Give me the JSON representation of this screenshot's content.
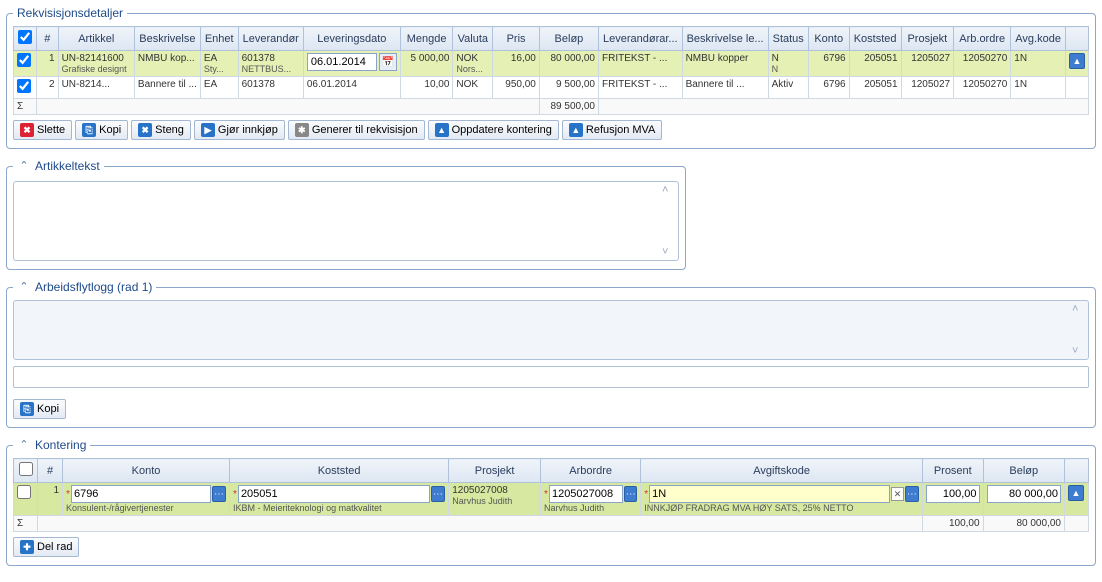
{
  "rekv": {
    "legend": "Rekvisisjonsdetaljer",
    "headers": [
      "#",
      "Artikkel",
      "Beskrivelse",
      "Enhet",
      "Leverandør",
      "Leveringsdato",
      "Mengde",
      "Valuta",
      "Pris",
      "Beløp",
      "Leverandørar...",
      "Beskrivelse le...",
      "Status",
      "Konto",
      "Koststed",
      "Prosjekt",
      "Arb.ordre",
      "Avg.kode"
    ],
    "rows": [
      {
        "num": "1",
        "art": "UN-82141600",
        "art_sub": "Grafiske designt",
        "besk": "NMBU kop...",
        "enh": "EA",
        "enh_sub": "Sty...",
        "lev": "601378",
        "lev_sub": "NETTBUS...",
        "levd": "06.01.2014",
        "meng": "5 000,00",
        "val": "NOK",
        "val_sub": "Nors...",
        "pris": "16,00",
        "bel": "80 000,00",
        "levar": "FRITEKST - ...",
        "beskl": "NMBU kopper",
        "stat": "N",
        "stat_sub": "N",
        "konto": "6796",
        "kost": "205051",
        "pros": "1205027",
        "arb": "12050270",
        "avg": "1N",
        "selected": true
      },
      {
        "num": "2",
        "art": "UN-8214...",
        "besk": "Bannere til ...",
        "enh": "EA",
        "lev": "601378",
        "levd": "06.01.2014",
        "meng": "10,00",
        "val": "NOK",
        "pris": "950,00",
        "bel": "9 500,00",
        "levar": "FRITEKST - ...",
        "beskl": "Bannere til ...",
        "stat": "Aktiv",
        "konto": "6796",
        "kost": "205051",
        "pros": "1205027",
        "arb": "12050270",
        "avg": "1N",
        "selected": true
      }
    ],
    "sum_label": "Σ",
    "sum_bel": "89 500,00",
    "buttons": {
      "slette": "Slette",
      "kopi": "Kopi",
      "steng": "Steng",
      "gjor": "Gjør innkjøp",
      "gen": "Generer til rekvisisjon",
      "opp": "Oppdatere kontering",
      "ref": "Refusjon MVA"
    }
  },
  "artikkel": {
    "legend": "Artikkeltekst"
  },
  "logg": {
    "legend": "Arbeidsflytlogg (rad 1)",
    "kopi": "Kopi"
  },
  "kontering": {
    "legend": "Kontering",
    "headers": [
      "#",
      "Konto",
      "Koststed",
      "Prosjekt",
      "Arbordre",
      "Avgiftskode",
      "Prosent",
      "Beløp"
    ],
    "row": {
      "num": "1",
      "konto": "6796",
      "konto_desc": "Konsulent-/rågivertjenester",
      "kost": "205051",
      "kost_desc": "IKBM - Meieriteknologi og matkvalitet",
      "pros": "1205027008",
      "pros_desc": "Narvhus Judith",
      "arb": "1205027008",
      "arb_desc": "Narvhus Judith",
      "avg": "1N",
      "avg_desc": "INNKJØP FRADRAG MVA HØY SATS, 25% NETTO",
      "pct": "100,00",
      "bel": "80 000,00"
    },
    "sum_pct": "100,00",
    "sum_bel": "80 000,00",
    "delrad": "Del rad"
  }
}
